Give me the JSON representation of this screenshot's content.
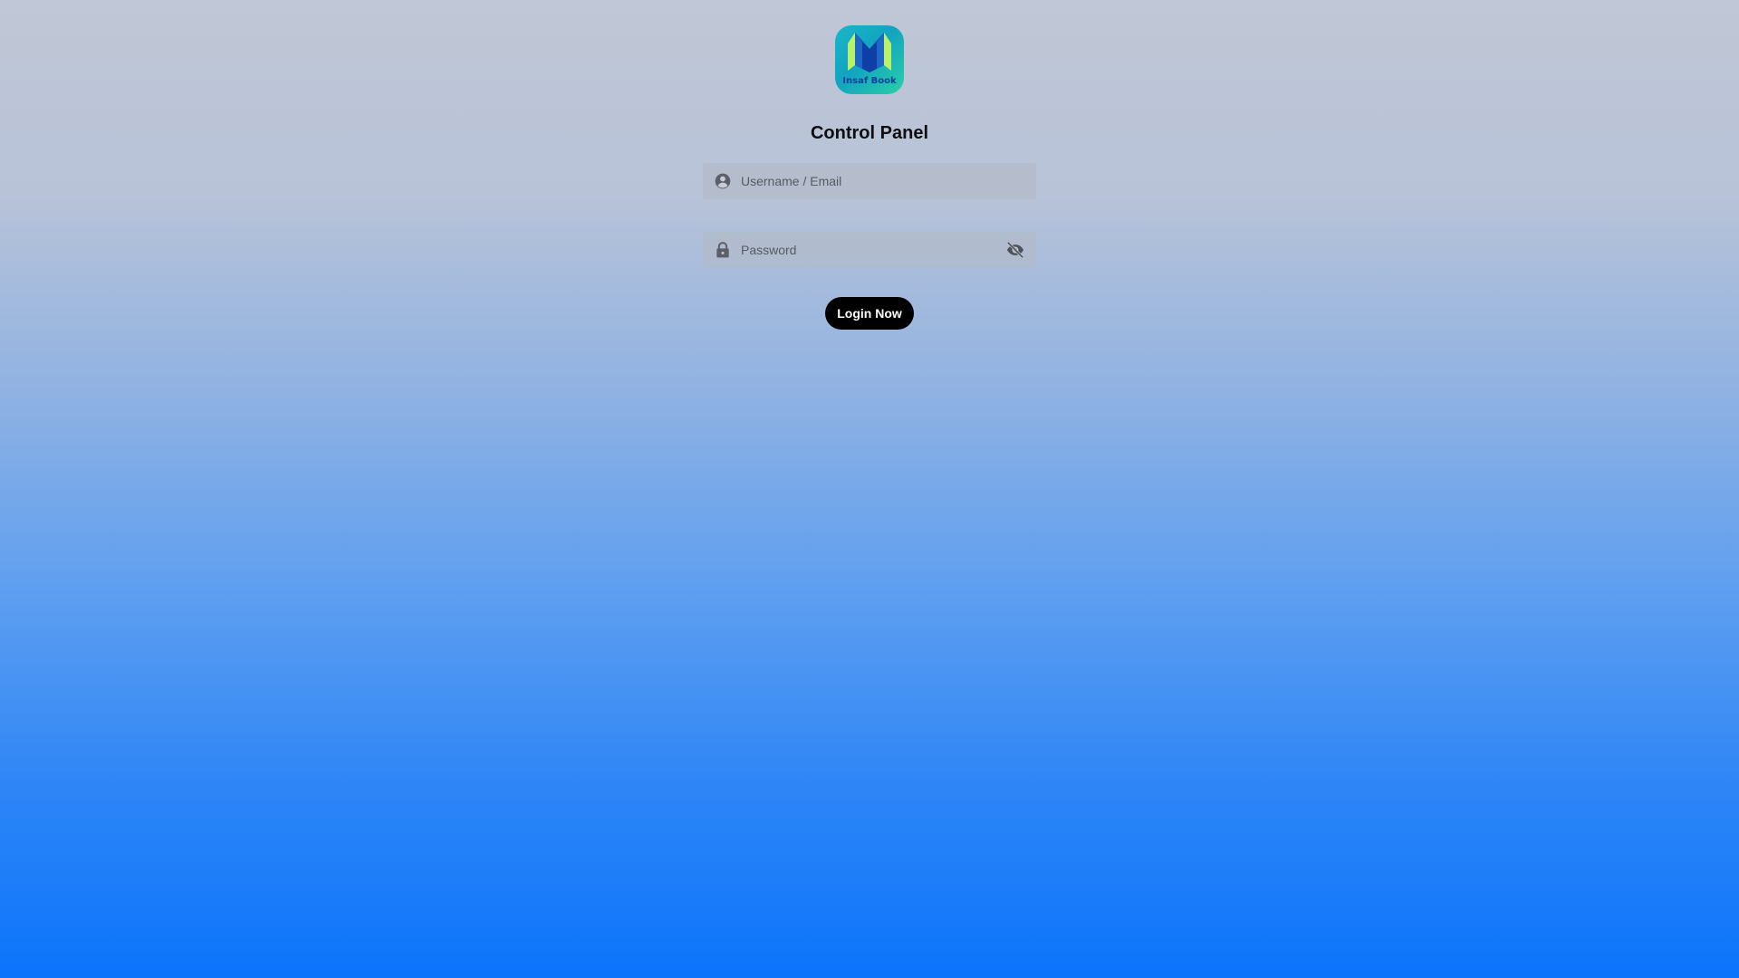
{
  "logo": {
    "text": "Insaf Book",
    "colors": {
      "background": "#17b3c6",
      "mark_dark": "#0d3fa6",
      "mark_light": "#b9f26a"
    }
  },
  "title": "Control Panel",
  "username_field": {
    "placeholder": "Username / Email",
    "value": "",
    "icon": "account-circle-icon"
  },
  "password_field": {
    "placeholder": "Password",
    "value": "",
    "icon": "lock-icon",
    "toggle_icon": "eye-off-icon"
  },
  "login_button": {
    "label": "Login Now"
  },
  "colors": {
    "background_top": "#c0c7d6",
    "background_bottom": "#0b74fb",
    "button": "#000000",
    "button_text": "#ffffff"
  }
}
